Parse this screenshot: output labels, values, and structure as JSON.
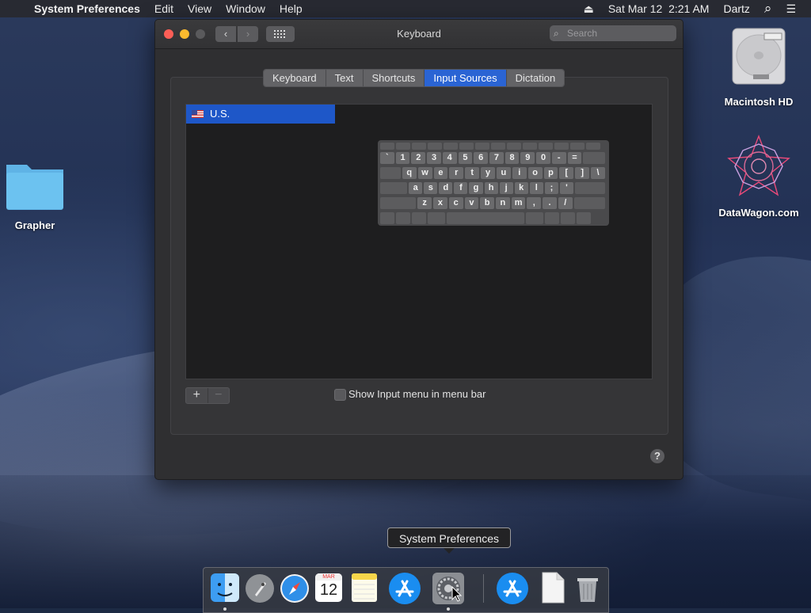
{
  "menubar": {
    "apple_icon": "",
    "app_name": "System Preferences",
    "menus": [
      "Edit",
      "View",
      "Window",
      "Help"
    ],
    "datetime": "Sat Mar 12  2:21 AM",
    "user": "Dartz",
    "eject_icon": "⏏",
    "search_icon": "⌕",
    "list_icon": "☰"
  },
  "desktop": {
    "icons": [
      {
        "label": "Macintosh HD"
      },
      {
        "label": "DataWagon.com"
      },
      {
        "label": "Grapher"
      }
    ]
  },
  "window": {
    "title": "Keyboard",
    "search_placeholder": "Search",
    "back_glyph": "‹",
    "forward_glyph": "›",
    "tabs": [
      {
        "label": "Keyboard",
        "active": false
      },
      {
        "label": "Text",
        "active": false
      },
      {
        "label": "Shortcuts",
        "active": false
      },
      {
        "label": "Input Sources",
        "active": true
      },
      {
        "label": "Dictation",
        "active": false
      }
    ],
    "input_sources": [
      {
        "label": "U.S.",
        "selected": true
      }
    ],
    "add_glyph": "+",
    "remove_glyph": "−",
    "show_input_menu_label": "Show Input menu in menu bar",
    "show_input_menu_checked": false,
    "help_glyph": "?"
  },
  "keyboard_preview": {
    "row1": [
      "`",
      "1",
      "2",
      "3",
      "4",
      "5",
      "6",
      "7",
      "8",
      "9",
      "0",
      "-",
      "="
    ],
    "row2": [
      "q",
      "w",
      "e",
      "r",
      "t",
      "y",
      "u",
      "i",
      "o",
      "p",
      "[",
      "]",
      "\\"
    ],
    "row3": [
      "a",
      "s",
      "d",
      "f",
      "g",
      "h",
      "j",
      "k",
      "l",
      ";",
      "'"
    ],
    "row4": [
      "z",
      "x",
      "c",
      "v",
      "b",
      "n",
      "m",
      ",",
      ".",
      "/"
    ]
  },
  "tooltip": "System Preferences",
  "dock": {
    "calendar_month": "MAR",
    "calendar_day": "12",
    "apps": [
      "Finder",
      "Launchpad",
      "Safari",
      "Calendar",
      "Notes",
      "App Store",
      "System Preferences",
      "App Store Downloads",
      "Document",
      "Trash"
    ]
  }
}
